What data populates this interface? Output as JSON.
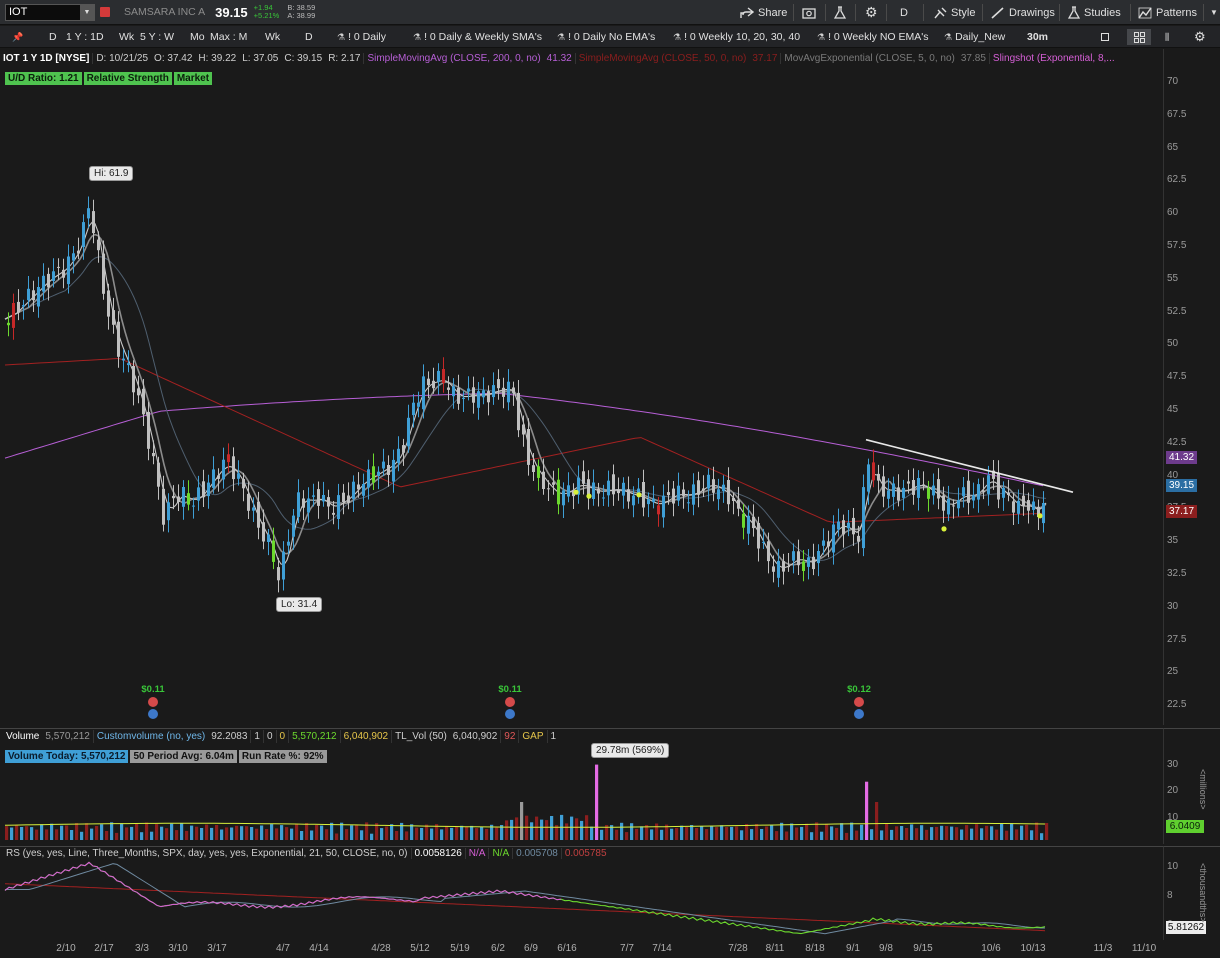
{
  "header": {
    "symbol": "IOT",
    "company": "SAMSARA INC A",
    "last": "39.15",
    "change": "+1.94",
    "change_pct": "+5.21%",
    "bid": "B: 38.59",
    "ask": "A: 38.99",
    "share": "Share",
    "timeframe": "D",
    "style": "Style",
    "drawings": "Drawings",
    "studies": "Studies",
    "patterns": "Patterns"
  },
  "toolbar2": {
    "items": [
      "D",
      "1 Y : 1D",
      "Wk",
      "5 Y : W",
      "Mo",
      "Max : M",
      "Wk",
      "D"
    ],
    "studies": [
      "! 0 Daily",
      "! 0 Daily & Weekly SMA's",
      "! 0 Daily No EMA's",
      "! 0 Weekly 10, 20, 30, 40",
      "! 0 Weekly NO EMA's",
      "Daily_New"
    ],
    "interval": "30m"
  },
  "price_info": {
    "title": "IOT 1 Y 1D [NYSE]",
    "date": "D: 10/21/25",
    "open": "O: 37.42",
    "high": "H: 39.22",
    "low": "L: 37.05",
    "close": "C: 39.15",
    "range": "R: 2.17",
    "sma200": "SimpleMovingAvg (CLOSE, 200, 0, no)",
    "sma200_val": "41.32",
    "sma50": "SimpleMovingAvg (CLOSE, 50, 0, no)",
    "sma50_val": "37.17",
    "ema5": "MovAvgExponential (CLOSE, 5, 0, no)",
    "ema5_val": "37.85",
    "slingshot": "Slingshot (Exponential, 8,..."
  },
  "tags": [
    "U/D Ratio: 1.21",
    "Relative Strength",
    "Market"
  ],
  "callouts": {
    "hi": "Hi: 61.9",
    "lo": "Lo: 31.4",
    "vol_peak": "29.78m (569%)"
  },
  "earnings": [
    "$0.11",
    "$0.11",
    "$0.12"
  ],
  "price_axis": {
    "ticks": [
      "70",
      "67.5",
      "65",
      "62.5",
      "60",
      "57.5",
      "55",
      "52.5",
      "50",
      "47.5",
      "45",
      "42.5",
      "40",
      "37.5",
      "35",
      "32.5",
      "30",
      "27.5",
      "25",
      "22.5"
    ],
    "tag_sma200": "41.32",
    "tag_last": "39.15",
    "tag_sma50": "37.17"
  },
  "volume": {
    "label": "Volume",
    "value": "5,570,212",
    "custom": "Customvolume (no, yes)",
    "custom_val": "92.2083",
    "f1": "1",
    "f2": "0",
    "f3": "0",
    "v1": "5,570,212",
    "v2": "6,040,902",
    "tl": "TL_Vol (50)",
    "tl_val": "6,040,902",
    "tl2": "92",
    "gap": "GAP",
    "gap_val": "1",
    "today": "Volume Today: 5,570,212",
    "avg": "50 Period Avg: 6.04m",
    "run": "Run Rate %: 92%",
    "ticks": [
      "30",
      "20",
      "10"
    ],
    "tag": "6.0409",
    "unit": "<millions>"
  },
  "rs": {
    "label": "RS (yes, yes, Line, Three_Months, SPX, day, yes, yes, Exponential, 21, 50, CLOSE, no, 0)",
    "v1": "0.0058126",
    "v2": "N/A",
    "v3": "N/A",
    "v4": "0.005708",
    "v5": "0.005785",
    "ticks": [
      "10",
      "8",
      "6"
    ],
    "tag": "5.81262",
    "unit": "<thousandths>",
    "tag_bottom": "5.8-2"
  },
  "x_axis": [
    "2/10",
    "2/17",
    "3/3",
    "3/10",
    "3/17",
    "4/7",
    "4/14",
    "4/28",
    "5/12",
    "5/19",
    "6/2",
    "6/9",
    "6/16",
    "7/7",
    "7/14",
    "7/28",
    "8/11",
    "8/18",
    "9/1",
    "9/8",
    "9/15",
    "10/6",
    "10/13",
    "11/3",
    "11/10"
  ],
  "colors": {
    "bg": "#1a1a1a",
    "up": "#3f9fd6",
    "down": "#c0c0c0",
    "green": "#6cd92e",
    "red": "#c62828",
    "purple": "#b75fd6",
    "sma50": "#a32121"
  }
}
